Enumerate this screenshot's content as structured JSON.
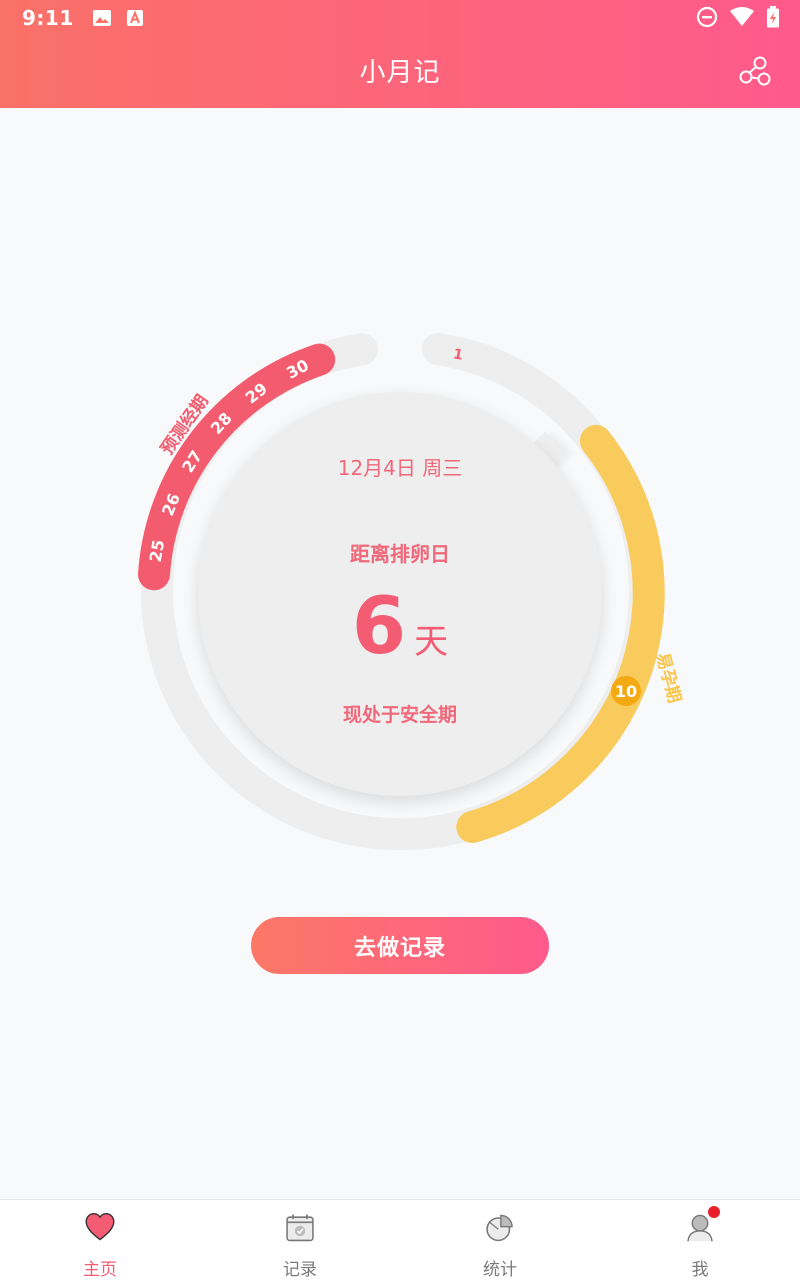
{
  "status_bar": {
    "time": "9:11"
  },
  "header": {
    "title": "小月记",
    "share_icon": "share-icon"
  },
  "ring": {
    "period_label": "预测经期",
    "period_days": [
      "25",
      "26",
      "27",
      "28",
      "29",
      "30"
    ],
    "cycle_start_label": "1",
    "fertile_label": "易孕期",
    "ovulation_day": "10",
    "colors": {
      "period": "#f25c6e",
      "fertile": "#f9cb5c",
      "track": "#eeeeee",
      "ovulation": "#f4a811"
    }
  },
  "center": {
    "date": "12月4日 周三",
    "label": "距离排卵日",
    "days_value": "6",
    "days_unit": "天",
    "status": "现处于安全期"
  },
  "cta": {
    "label": "去做记录"
  },
  "bottom_nav": [
    {
      "label": "主页",
      "icon": "heart-icon",
      "active": true
    },
    {
      "label": "记录",
      "icon": "calendar-icon",
      "active": false
    },
    {
      "label": "统计",
      "icon": "pie-chart-icon",
      "active": false
    },
    {
      "label": "我",
      "icon": "user-icon",
      "active": false,
      "badge": true
    }
  ],
  "colors": {
    "accent": "#f45c74",
    "header_start": "#fa7168",
    "header_end": "#ff5a8c"
  }
}
